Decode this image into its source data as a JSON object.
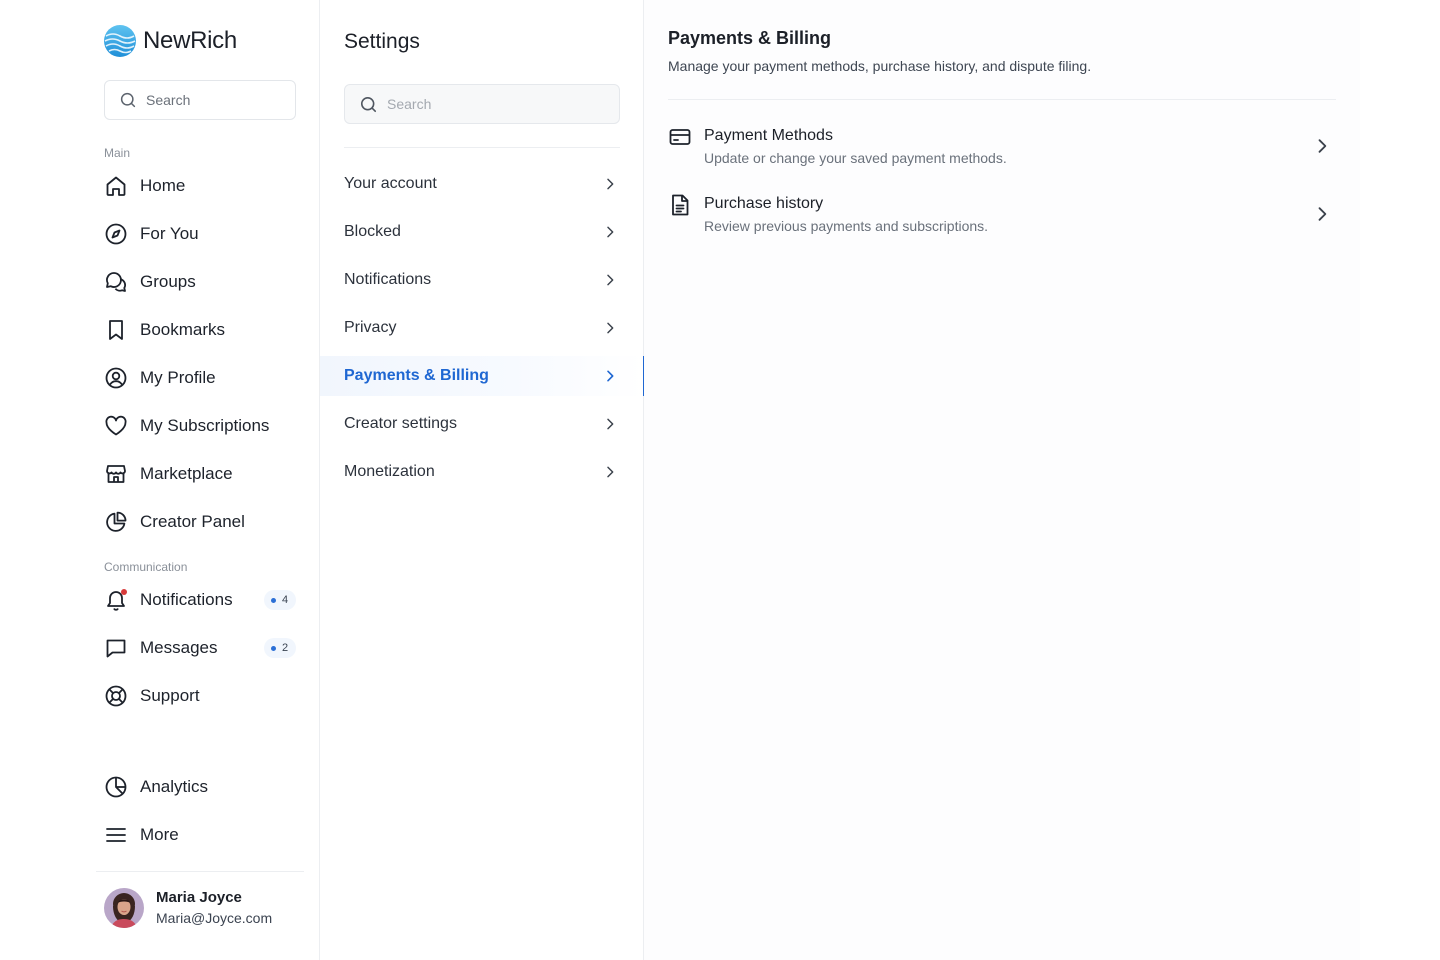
{
  "brand": {
    "name": "NewRich"
  },
  "sidebar": {
    "search_placeholder": "Search",
    "section_main": "Main",
    "main_items": [
      {
        "label": "Home",
        "icon": "home-icon"
      },
      {
        "label": "For You",
        "icon": "compass-icon"
      },
      {
        "label": "Groups",
        "icon": "chat-bubbles-icon"
      },
      {
        "label": "Bookmarks",
        "icon": "bookmark-icon"
      },
      {
        "label": "My Profile",
        "icon": "user-circle-icon"
      },
      {
        "label": "My Subscriptions",
        "icon": "heart-icon"
      },
      {
        "label": "Marketplace",
        "icon": "store-icon"
      },
      {
        "label": "Creator Panel",
        "icon": "pie-chart-icon"
      }
    ],
    "section_communication": "Communication",
    "comm_items": [
      {
        "label": "Notifications",
        "icon": "bell-icon",
        "badge": "4"
      },
      {
        "label": "Messages",
        "icon": "message-icon",
        "badge": "2"
      },
      {
        "label": "Support",
        "icon": "lifebuoy-icon"
      }
    ],
    "bottom_items": [
      {
        "label": "Analytics",
        "icon": "analytics-icon"
      },
      {
        "label": "More",
        "icon": "menu-icon"
      }
    ],
    "user": {
      "name": "Maria Joyce",
      "email": "Maria@Joyce.com"
    }
  },
  "settings": {
    "title": "Settings",
    "search_placeholder": "Search",
    "items": [
      {
        "label": "Your account"
      },
      {
        "label": "Blocked"
      },
      {
        "label": "Notifications"
      },
      {
        "label": "Privacy"
      },
      {
        "label": "Payments & Billing",
        "active": true
      },
      {
        "label": "Creator settings"
      },
      {
        "label": "Monetization"
      }
    ]
  },
  "main": {
    "title": "Payments & Billing",
    "subtitle": "Manage your payment methods, purchase history, and dispute filing.",
    "options": [
      {
        "title": "Payment Methods",
        "desc": "Update or change your saved payment methods.",
        "icon": "credit-card-icon"
      },
      {
        "title": "Purchase history",
        "desc": "Review previous payments and subscriptions.",
        "icon": "document-icon"
      }
    ]
  },
  "colors": {
    "accent": "#1f67d2",
    "active_bg": "#f1f6fd",
    "notification_dot": "#d83a3a"
  }
}
